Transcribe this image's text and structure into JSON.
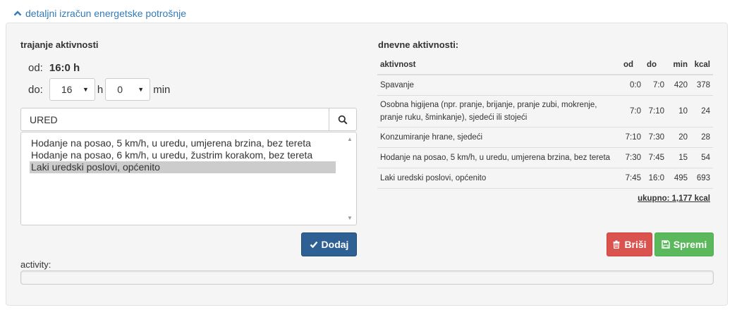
{
  "toggle": {
    "label": "detaljni izračun energetske potrošnje"
  },
  "left": {
    "title": "trajanje aktivnosti",
    "from_label": "od:",
    "from_value": "16:0 h",
    "to_label": "do:",
    "to_hour": "16",
    "hour_unit": "h",
    "to_min": "0",
    "min_unit": "min",
    "search": {
      "value": "URED"
    },
    "options": [
      {
        "label": "Hodanje na posao, 5 km/h, u uredu, umjerena brzina, bez tereta",
        "selected": false
      },
      {
        "label": "Hodanje na posao, 6 km/h, u uredu, žustrim korakom, bez tereta",
        "selected": false
      },
      {
        "label": "Laki uredski poslovi, općenito",
        "selected": true
      }
    ],
    "add_label": "Dodaj"
  },
  "right": {
    "title": "dnevne aktivnosti:",
    "columns": [
      "aktivnost",
      "od",
      "do",
      "min",
      "kcal"
    ],
    "rows": [
      [
        "Spavanje",
        "0:0",
        "7:0",
        "420",
        "378"
      ],
      [
        "Osobna higijena (npr. pranje, brijanje, pranje zubi, mokrenje, pranje ruku, šminkanje), sjedeći ili stojeći",
        "7:0",
        "7:10",
        "10",
        "24"
      ],
      [
        "Konzumiranje hrane, sjedeći",
        "7:10",
        "7:30",
        "20",
        "28"
      ],
      [
        "Hodanje na posao, 5 km/h, u uredu, umjerena brzina, bez tereta",
        "7:30",
        "7:45",
        "15",
        "54"
      ],
      [
        "Laki uredski poslovi, općenito",
        "7:45",
        "16:0",
        "495",
        "693"
      ]
    ],
    "total": "ukupno: 1,177 kcal",
    "delete_label": "Briši",
    "save_label": "Spremi"
  },
  "activity": {
    "label": "activity:",
    "progress": 0
  },
  "colors": {
    "link": "#337ab7",
    "primary": "#2e6094",
    "danger": "#d9534f",
    "success": "#5cb85c"
  }
}
